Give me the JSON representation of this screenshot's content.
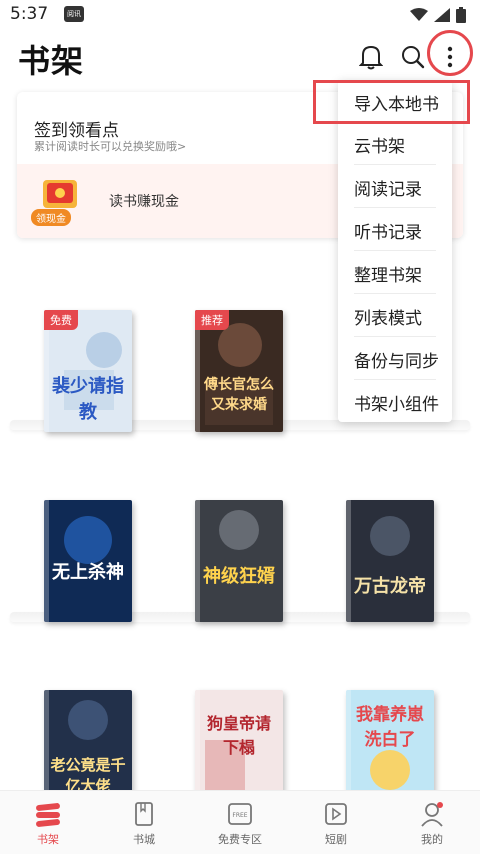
{
  "status_bar": {
    "time": "5:37",
    "app_badge": "阅讯"
  },
  "header": {
    "title": "书架"
  },
  "sign_card": {
    "title": "签到领看点",
    "subtitle": "累计阅读时长可以兑换奖励哦>",
    "coin_badge": "领现金",
    "earn_label": "读书赚现金"
  },
  "menu": {
    "items": [
      {
        "label": "导入本地书"
      },
      {
        "label": "云书架"
      },
      {
        "label": "阅读记录"
      },
      {
        "label": "听书记录"
      },
      {
        "label": "整理书架"
      },
      {
        "label": "列表模式"
      },
      {
        "label": "备份与同步"
      },
      {
        "label": "书架小组件"
      }
    ]
  },
  "books": [
    {
      "title": "裴少请指教",
      "tag": "免费",
      "tag_color": "#e5484d",
      "cover_color": "#dfe9f3",
      "title_color": "#2b59c3"
    },
    {
      "title": "傅长官怎么又来求婚",
      "tag": "推荐",
      "tag_color": "#e5484d",
      "cover_color": "#3a2a22",
      "title_color": "#ffd98a"
    },
    {
      "title": "无上杀神",
      "tag": "",
      "tag_color": "",
      "cover_color": "#0f2a55",
      "title_color": "#ffffff"
    },
    {
      "title": "神级狂婿",
      "tag": "",
      "tag_color": "",
      "cover_color": "#3b3f46",
      "title_color": "#ffd34d"
    },
    {
      "title": "万古龙帝",
      "tag": "",
      "tag_color": "",
      "cover_color": "#2a2f3b",
      "title_color": "#f5e2a8"
    },
    {
      "title": "老公竟是千亿大佬",
      "tag": "",
      "tag_color": "",
      "cover_color": "#22304a",
      "title_color": "#ffe08a"
    },
    {
      "title": "狗皇帝请下榻",
      "tag": "",
      "tag_color": "",
      "cover_color": "#f3e6e6",
      "title_color": "#b3262e"
    },
    {
      "title": "我靠养崽洗白了",
      "tag": "",
      "tag_color": "",
      "cover_color": "#bfe6f5",
      "title_color": "#e5484d"
    }
  ],
  "bottom_nav": [
    {
      "label": "书架",
      "active": true
    },
    {
      "label": "书城",
      "active": false
    },
    {
      "label": "免费专区",
      "active": false
    },
    {
      "label": "短剧",
      "active": false
    },
    {
      "label": "我的",
      "active": false
    }
  ]
}
